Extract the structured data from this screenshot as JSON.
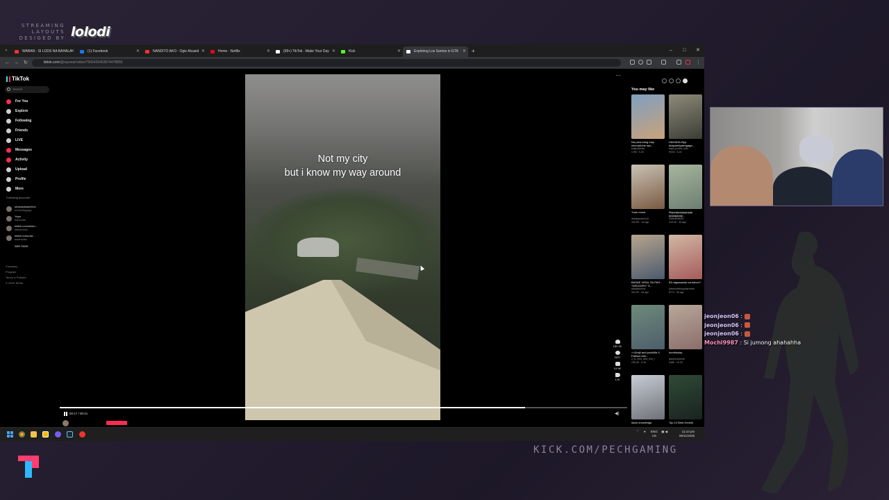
{
  "overlay": {
    "brand_small": "STREAMING LAYOUTS DESIGED BY",
    "brand_logo": "lolodi",
    "kick_url": "KICK.COM/PECHGAMING"
  },
  "chat": [
    {
      "user": "jeonjeon06",
      "sep": " : ",
      "msg": "",
      "emote": "emote"
    },
    {
      "user": "jeonjeon06",
      "sep": " : ",
      "msg": "",
      "emote": "emote"
    },
    {
      "user": "jeonjeon06",
      "sep": " : ",
      "msg": "",
      "emote": "emote"
    },
    {
      "user": "Mochi9987",
      "sep": " : ",
      "msg": "Si jumong ahahahha",
      "emote": ""
    }
  ],
  "browser": {
    "tabs": [
      {
        "label": "WABAN - SI LODS NA BAHALA",
        "color": "#ff3030"
      },
      {
        "label": "(1) Facebook",
        "color": "#1877f2"
      },
      {
        "label": "NANDITO AKO - Ogie Alcasid",
        "color": "#ff3030"
      },
      {
        "label": "Home - Netflix",
        "color": "#e50914"
      },
      {
        "label": "(99+) TikTok - Make Your Day",
        "color": "#ffffff"
      },
      {
        "label": "Kick",
        "color": "#53fc18"
      },
      {
        "label": "Exploring Los Santos in GTA",
        "color": "#ffffff"
      }
    ],
    "new_tab": "+",
    "win_controls": [
      "–",
      "□",
      "✕"
    ],
    "url_host": "tiktok.com",
    "url_path": "/@rayoear/video/7565426453674478855"
  },
  "tiktok": {
    "logo": "TikTok",
    "search_placeholder": "Search",
    "nav": [
      {
        "label": "For You",
        "icon": "home-icon",
        "red": true
      },
      {
        "label": "Explore",
        "icon": "compass-icon",
        "red": false
      },
      {
        "label": "Following",
        "icon": "following-icon",
        "red": false
      },
      {
        "label": "Friends",
        "icon": "friends-icon",
        "red": false
      },
      {
        "label": "LIVE",
        "icon": "live-icon",
        "red": false
      },
      {
        "label": "Messages",
        "icon": "messages-icon",
        "red": true
      },
      {
        "label": "Activity",
        "icon": "activity-icon",
        "red": true
      },
      {
        "label": "Upload",
        "icon": "upload-icon",
        "red": false
      },
      {
        "label": "Profile",
        "icon": "profile-icon",
        "red": false
      },
      {
        "label": "More",
        "icon": "more-icon",
        "red": false
      }
    ],
    "following_heading": "Following accounts",
    "following": [
      {
        "name": "ukasasasaschiva",
        "sub": "uvvvtolsyyyyy"
      },
      {
        "name": "Yaya",
        "sub": "hsmrclas"
      },
      {
        "name": "twitch.com/shido...",
        "sub": "shikomoric"
      },
      {
        "name": "twitch.tv/ssoda...",
        "sub": "ssothvdss"
      }
    ],
    "see_more": "See more",
    "footer": [
      "Company",
      "Program",
      "Terms & Policies",
      "© 2025 TikTok"
    ],
    "video": {
      "caption_line1": "Not my city",
      "caption_line2": "but i know my way around",
      "time": "00:17 / 00:21",
      "progress": 0.82,
      "likes": "182.2K",
      "comments": "2027",
      "saves": "19.9K",
      "shares": "17K"
    },
    "you_may_like": "You may like",
    "recs": [
      {
        "title": "Na para bang may microphone sys...",
        "meta": "kaiyhyashey",
        "stats": "1.9M · 9-30",
        "c1": "#7f9fc0",
        "c2": "#c9a27a"
      },
      {
        "title": "HAHAHA #fyp #kapamilyaengaga...",
        "meta": "kaya_justine_edtz",
        "stats": "90mil · 8-18",
        "c1": "#8e8a7a",
        "c2": "#3b3d35"
      },
      {
        "title": "Yuan mona",
        "meta": "daddyseanne16",
        "stats": "415.9K · 1w ago",
        "c1": "#c9c2b6",
        "c2": "#7a5a40"
      },
      {
        "title": "#fyppppppppppppp ppppppppp...",
        "meta": "useentha9r80",
        "stats": "215.4K · 4d ago",
        "c1": "#a7b59d",
        "c2": "#6c7f72"
      },
      {
        "title": "BASAE VIRAL SA PAG-\"GROCERY\" S...",
        "meta": "albasteneww",
        "stats": "344.3K · 4d ago",
        "c1": "#b7a58d",
        "c2": "#4b5a6e"
      },
      {
        "title": "Eli nagsawsaw sa Asbcn?",
        "meta": "pibbconfebdypelarmnen",
        "stats": "8774 · 3d ago",
        "c1": "#d1b8a4",
        "c2": "#a65b5b"
      },
      {
        "title": ">>Dorjil and pochillia X Fatima rock...",
        "meta": "2_is_next_ufec_this_f",
        "stats": "235.4K · 9-29",
        "c1": "#6e8a7a",
        "c2": "#4d5e6c"
      },
      {
        "title": "#onthisday",
        "meta": "jasonmoments",
        "stats": "2488 · 10-29",
        "c1": "#b8a89a",
        "c2": "#8a6e6a"
      },
      {
        "title": "stock knowledge",
        "meta": "",
        "stats": "",
        "c1": "#c7ccd5",
        "c2": "#6f7277"
      },
      {
        "title": "Top 10 Best Genshi",
        "meta": "",
        "stats": "",
        "c1": "#2f4a37",
        "c2": "#1a2320"
      }
    ]
  },
  "taskbar": {
    "lang1": "ENG",
    "lang2": "US",
    "time": "11:10 pm",
    "date": "06/11/2025"
  }
}
